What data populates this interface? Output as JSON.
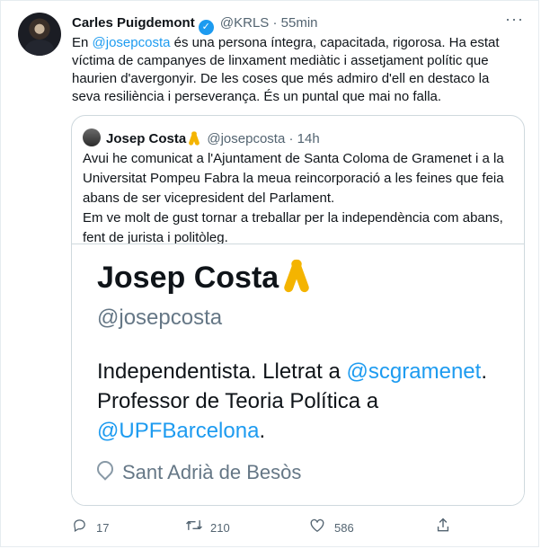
{
  "tweet": {
    "author": "Carles Puigdemont",
    "handle": "@KRLS",
    "separator": "·",
    "time": "55min",
    "mention": "@josepcosta",
    "text_rest": " és una persona íntegra, capacitada, rigorosa. Ha estat víctima de campanyes de linxament mediàtic i assetjament polític que haurien d'avergonyir. De les coses que més admiro d'ell en destaco la seva resiliència i perseverança. És un puntal que mai no falla.",
    "text_prefix": "En "
  },
  "quote": {
    "author": "Josep Costa",
    "handle": "@josepcosta",
    "time": "14h",
    "text_line1": "Avui he comunicat a l'Ajuntament de Santa Coloma de Gramenet i a la Universitat Pompeu Fabra la meua reincorporació a les feines que feia abans de ser vicepresident del Parlament.",
    "text_line2": "Em ve molt de gust tornar a treballar per la independència com abans, fent de jurista i politòleg.",
    "card": {
      "name": "Josep Costa",
      "handle": "@josepcosta",
      "bio_prefix": "Independentista. Lletrat a ",
      "bio_link1": "@scgramenet",
      "bio_middle": ". Professor de Teoria Política a ",
      "bio_link2": "@UPFBarcelona",
      "bio_suffix": ".",
      "location": "Sant Adrià de Besòs"
    }
  },
  "actions": {
    "reply_count": "17",
    "retweet_count": "210",
    "like_count": "586",
    "icons": [
      "reply-icon",
      "retweet-icon",
      "like-icon",
      "share-icon"
    ]
  },
  "colors": {
    "link": "#1d9bf0",
    "muted": "#536471",
    "ribbon": "#f4b400"
  }
}
